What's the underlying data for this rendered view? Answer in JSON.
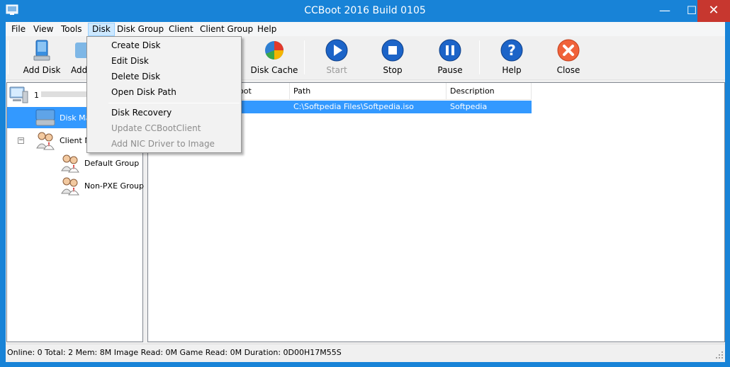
{
  "window": {
    "title": "CCBoot 2016 Build 0105",
    "min_glyph": "—",
    "max_glyph": "☐",
    "close_glyph": "✕"
  },
  "menubar": {
    "items": [
      {
        "label": "File"
      },
      {
        "label": "View"
      },
      {
        "label": "Tools"
      },
      {
        "label": "Disk",
        "active": true
      },
      {
        "label": "Disk Group"
      },
      {
        "label": "Client"
      },
      {
        "label": "Client Group"
      },
      {
        "label": "Help"
      }
    ]
  },
  "toolbar": {
    "buttons": [
      {
        "label": "Add Disk",
        "icon": "add-disk-icon",
        "enabled": true
      },
      {
        "label": "Add",
        "icon": "add-icon",
        "enabled": true
      },
      {
        "label": "Disk Cache",
        "icon": "disk-cache-icon",
        "enabled": true
      },
      {
        "label": "Start",
        "icon": "play-icon",
        "enabled": false
      },
      {
        "label": "Stop",
        "icon": "stop-icon",
        "enabled": true
      },
      {
        "label": "Pause",
        "icon": "pause-icon",
        "enabled": true
      },
      {
        "label": "Help",
        "icon": "help-icon",
        "enabled": true
      },
      {
        "label": "Close",
        "icon": "close-icon",
        "enabled": true
      }
    ]
  },
  "tree": {
    "root_label": "1",
    "items": [
      {
        "label": "Disk Ma",
        "icon": "disk-icon",
        "selected": true
      },
      {
        "label": "Client M",
        "icon": "clients-icon",
        "expander": "−"
      },
      {
        "label": "Default Group",
        "icon": "group-icon"
      },
      {
        "label": "Non-PXE Group",
        "icon": "group-icon"
      }
    ]
  },
  "list": {
    "columns": [
      "oot",
      "Path",
      "Description"
    ],
    "rows": [
      {
        "path": "C:\\Softpedia Files\\Softpedia.iso",
        "description": "Softpedia"
      }
    ]
  },
  "status": {
    "text": "Online: 0 Total: 2 Mem: 8M Image Read: 0M Game Read: 0M Duration: 0D00H17M55S"
  },
  "disk_menu": {
    "items": [
      {
        "label": "Create Disk",
        "enabled": true
      },
      {
        "label": "Edit Disk",
        "enabled": true
      },
      {
        "label": "Delete Disk",
        "enabled": true
      },
      {
        "label": "Open Disk Path",
        "enabled": true
      },
      {
        "label": "Disk Recovery",
        "enabled": true
      },
      {
        "label": "Update CCBootClient",
        "enabled": false
      },
      {
        "label": "Add NIC Driver to Image",
        "enabled": false
      }
    ]
  },
  "colors": {
    "title_bar": "#1883d7",
    "selection": "#3399ff",
    "close_button": "#c7372f"
  }
}
